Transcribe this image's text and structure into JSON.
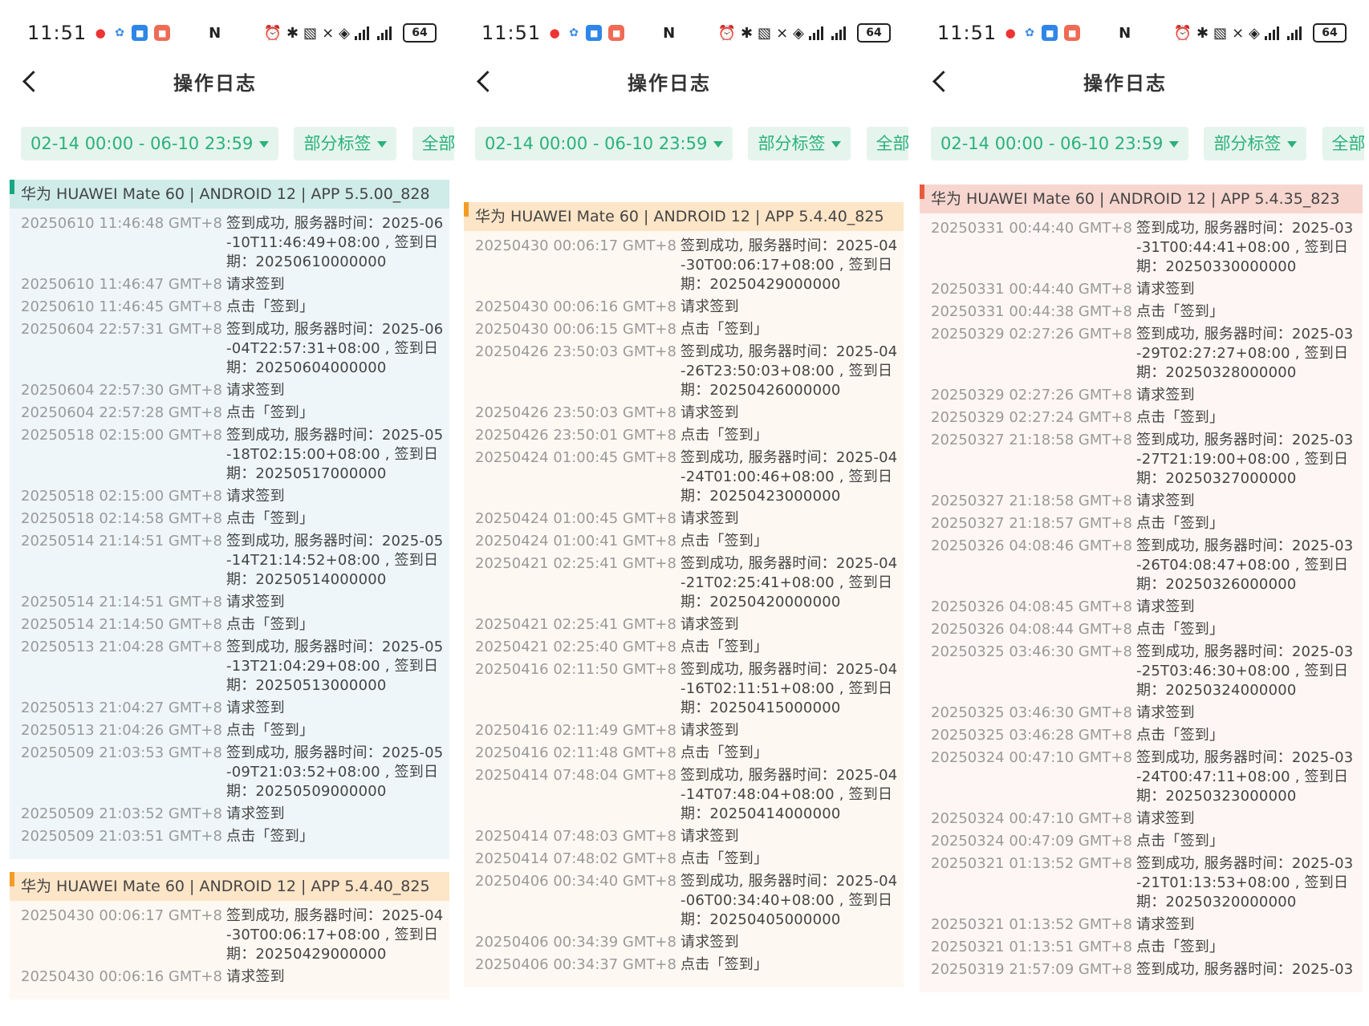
{
  "colors": {
    "accent": "#29b27a",
    "chip_bg": "#e6f4ee",
    "group_blue": "#cfece9",
    "group_orange": "#fde5c7",
    "group_red": "#f7d6cf"
  },
  "status_bar": {
    "time": "11:51",
    "battery": "64",
    "icons": [
      "qq-icon",
      "pinwheel-icon",
      "app-icon",
      "app-icon",
      "nfc-icon",
      "alarm-icon",
      "bluetooth-icon",
      "vibrate-icon",
      "mute-icon",
      "wifi-icon",
      "signal-icon",
      "signal-icon",
      "battery-icon"
    ]
  },
  "nav": {
    "title": "操作日志"
  },
  "filters": {
    "date_range": "02-14 00:00 - 06-10 23:59",
    "tags": "部分标签",
    "all": "全部"
  },
  "panels": [
    {
      "groups": [
        {
          "color": "blue",
          "header": "华为 HUAWEI Mate 60 | ANDROID 12 | APP 5.5.00_828",
          "entries": [
            {
              "ts": "20250610 11:46:48 GMT+8",
              "msg": [
                "签到成功, 服务器时间：2025-06",
                "-10T11:46:49+08:00 , 签到日",
                "期：20250610000000"
              ]
            },
            {
              "ts": "20250610 11:46:47 GMT+8",
              "msg": [
                "请求签到"
              ]
            },
            {
              "ts": "20250610 11:46:45 GMT+8",
              "msg": [
                "点击「签到」"
              ]
            },
            {
              "ts": "20250604 22:57:31 GMT+8",
              "msg": [
                "签到成功, 服务器时间：2025-06",
                "-04T22:57:31+08:00 , 签到日",
                "期：20250604000000"
              ]
            },
            {
              "ts": "20250604 22:57:30 GMT+8",
              "msg": [
                "请求签到"
              ]
            },
            {
              "ts": "20250604 22:57:28 GMT+8",
              "msg": [
                "点击「签到」"
              ]
            },
            {
              "ts": "20250518 02:15:00 GMT+8",
              "msg": [
                "签到成功, 服务器时间：2025-05",
                "-18T02:15:00+08:00 , 签到日",
                "期：20250517000000"
              ]
            },
            {
              "ts": "20250518 02:15:00 GMT+8",
              "msg": [
                "请求签到"
              ]
            },
            {
              "ts": "20250518 02:14:58 GMT+8",
              "msg": [
                "点击「签到」"
              ]
            },
            {
              "ts": "20250514 21:14:51 GMT+8",
              "msg": [
                "签到成功, 服务器时间：2025-05",
                "-14T21:14:52+08:00 , 签到日",
                "期：20250514000000"
              ]
            },
            {
              "ts": "20250514 21:14:51 GMT+8",
              "msg": [
                "请求签到"
              ]
            },
            {
              "ts": "20250514 21:14:50 GMT+8",
              "msg": [
                "点击「签到」"
              ]
            },
            {
              "ts": "20250513 21:04:28 GMT+8",
              "msg": [
                "签到成功, 服务器时间：2025-05",
                "-13T21:04:29+08:00 , 签到日",
                "期：20250513000000"
              ]
            },
            {
              "ts": "20250513 21:04:27 GMT+8",
              "msg": [
                "请求签到"
              ]
            },
            {
              "ts": "20250513 21:04:26 GMT+8",
              "msg": [
                "点击「签到」"
              ]
            },
            {
              "ts": "20250509 21:03:53 GMT+8",
              "msg": [
                "签到成功, 服务器时间：2025-05",
                "-09T21:03:52+08:00 , 签到日",
                "期：20250509000000"
              ]
            },
            {
              "ts": "20250509 21:03:52 GMT+8",
              "msg": [
                "请求签到"
              ]
            },
            {
              "ts": "20250509 21:03:51 GMT+8",
              "msg": [
                "点击「签到」"
              ]
            }
          ]
        },
        {
          "color": "orange",
          "header": "华为 HUAWEI Mate 60 | ANDROID 12 | APP 5.4.40_825",
          "entries": [
            {
              "ts": "20250430 00:06:17 GMT+8",
              "msg": [
                "签到成功, 服务器时间：2025-04",
                "-30T00:06:17+08:00 , 签到日",
                "期：20250429000000"
              ]
            },
            {
              "ts": "20250430 00:06:16 GMT+8",
              "msg": [
                "请求签到"
              ]
            }
          ]
        }
      ]
    },
    {
      "groups": [
        {
          "color": "orange",
          "header": "华为 HUAWEI Mate 60 | ANDROID 12 | APP 5.4.40_825",
          "entries": [
            {
              "ts": "20250430 00:06:17 GMT+8",
              "msg": [
                "签到成功, 服务器时间：2025-04",
                "-30T00:06:17+08:00 , 签到日",
                "期：20250429000000"
              ]
            },
            {
              "ts": "20250430 00:06:16 GMT+8",
              "msg": [
                "请求签到"
              ]
            },
            {
              "ts": "20250430 00:06:15 GMT+8",
              "msg": [
                "点击「签到」"
              ]
            },
            {
              "ts": "20250426 23:50:03 GMT+8",
              "msg": [
                "签到成功, 服务器时间：2025-04",
                "-26T23:50:03+08:00 , 签到日",
                "期：20250426000000"
              ]
            },
            {
              "ts": "20250426 23:50:03 GMT+8",
              "msg": [
                "请求签到"
              ]
            },
            {
              "ts": "20250426 23:50:01 GMT+8",
              "msg": [
                "点击「签到」"
              ]
            },
            {
              "ts": "20250424 01:00:45 GMT+8",
              "msg": [
                "签到成功, 服务器时间：2025-04",
                "-24T01:00:46+08:00 , 签到日",
                "期：20250423000000"
              ]
            },
            {
              "ts": "20250424 01:00:45 GMT+8",
              "msg": [
                "请求签到"
              ]
            },
            {
              "ts": "20250424 01:00:41 GMT+8",
              "msg": [
                "点击「签到」"
              ]
            },
            {
              "ts": "20250421 02:25:41 GMT+8",
              "msg": [
                "签到成功, 服务器时间：2025-04",
                "-21T02:25:41+08:00 , 签到日",
                "期：20250420000000"
              ]
            },
            {
              "ts": "20250421 02:25:41 GMT+8",
              "msg": [
                "请求签到"
              ]
            },
            {
              "ts": "20250421 02:25:40 GMT+8",
              "msg": [
                "点击「签到」"
              ]
            },
            {
              "ts": "20250416 02:11:50 GMT+8",
              "msg": [
                "签到成功, 服务器时间：2025-04",
                "-16T02:11:51+08:00 , 签到日",
                "期：20250415000000"
              ]
            },
            {
              "ts": "20250416 02:11:49 GMT+8",
              "msg": [
                "请求签到"
              ]
            },
            {
              "ts": "20250416 02:11:48 GMT+8",
              "msg": [
                "点击「签到」"
              ]
            },
            {
              "ts": "20250414 07:48:04 GMT+8",
              "msg": [
                "签到成功, 服务器时间：2025-04",
                "-14T07:48:04+08:00 , 签到日",
                "期：20250414000000"
              ]
            },
            {
              "ts": "20250414 07:48:03 GMT+8",
              "msg": [
                "请求签到"
              ]
            },
            {
              "ts": "20250414 07:48:02 GMT+8",
              "msg": [
                "点击「签到」"
              ]
            },
            {
              "ts": "20250406 00:34:40 GMT+8",
              "msg": [
                "签到成功, 服务器时间：2025-04",
                "-06T00:34:40+08:00 , 签到日",
                "期：20250405000000"
              ]
            },
            {
              "ts": "20250406 00:34:39 GMT+8",
              "msg": [
                "请求签到"
              ]
            },
            {
              "ts": "20250406 00:34:37 GMT+8",
              "msg": [
                "点击「签到」"
              ]
            }
          ]
        }
      ]
    },
    {
      "groups": [
        {
          "color": "red",
          "header": "华为 HUAWEI Mate 60 | ANDROID 12 | APP 5.4.35_823",
          "entries": [
            {
              "ts": "20250331 00:44:40 GMT+8",
              "msg": [
                "签到成功, 服务器时间：2025-03",
                "-31T00:44:41+08:00 , 签到日",
                "期：20250330000000"
              ]
            },
            {
              "ts": "20250331 00:44:40 GMT+8",
              "msg": [
                "请求签到"
              ]
            },
            {
              "ts": "20250331 00:44:38 GMT+8",
              "msg": [
                "点击「签到」"
              ]
            },
            {
              "ts": "20250329 02:27:26 GMT+8",
              "msg": [
                "签到成功, 服务器时间：2025-03",
                "-29T02:27:27+08:00 , 签到日",
                "期：20250328000000"
              ]
            },
            {
              "ts": "20250329 02:27:26 GMT+8",
              "msg": [
                "请求签到"
              ]
            },
            {
              "ts": "20250329 02:27:24 GMT+8",
              "msg": [
                "点击「签到」"
              ]
            },
            {
              "ts": "20250327 21:18:58 GMT+8",
              "msg": [
                "签到成功, 服务器时间：2025-03",
                "-27T21:19:00+08:00 , 签到日",
                "期：20250327000000"
              ]
            },
            {
              "ts": "20250327 21:18:58 GMT+8",
              "msg": [
                "请求签到"
              ]
            },
            {
              "ts": "20250327 21:18:57 GMT+8",
              "msg": [
                "点击「签到」"
              ]
            },
            {
              "ts": "20250326 04:08:46 GMT+8",
              "msg": [
                "签到成功, 服务器时间：2025-03",
                "-26T04:08:47+08:00 , 签到日",
                "期：20250326000000"
              ]
            },
            {
              "ts": "20250326 04:08:45 GMT+8",
              "msg": [
                "请求签到"
              ]
            },
            {
              "ts": "20250326 04:08:44 GMT+8",
              "msg": [
                "点击「签到」"
              ]
            },
            {
              "ts": "20250325 03:46:30 GMT+8",
              "msg": [
                "签到成功, 服务器时间：2025-03",
                "-25T03:46:30+08:00 , 签到日",
                "期：20250324000000"
              ]
            },
            {
              "ts": "20250325 03:46:30 GMT+8",
              "msg": [
                "请求签到"
              ]
            },
            {
              "ts": "20250325 03:46:28 GMT+8",
              "msg": [
                "点击「签到」"
              ]
            },
            {
              "ts": "20250324 00:47:10 GMT+8",
              "msg": [
                "签到成功, 服务器时间：2025-03",
                "-24T00:47:11+08:00 , 签到日",
                "期：20250323000000"
              ]
            },
            {
              "ts": "20250324 00:47:10 GMT+8",
              "msg": [
                "请求签到"
              ]
            },
            {
              "ts": "20250324 00:47:09 GMT+8",
              "msg": [
                "点击「签到」"
              ]
            },
            {
              "ts": "20250321 01:13:52 GMT+8",
              "msg": [
                "签到成功, 服务器时间：2025-03",
                "-21T01:13:53+08:00 , 签到日",
                "期：20250320000000"
              ]
            },
            {
              "ts": "20250321 01:13:52 GMT+8",
              "msg": [
                "请求签到"
              ]
            },
            {
              "ts": "20250321 01:13:51 GMT+8",
              "msg": [
                "点击「签到」"
              ]
            },
            {
              "ts": "20250319 21:57:09 GMT+8",
              "msg": [
                "签到成功, 服务器时间：2025-03"
              ]
            }
          ]
        }
      ]
    }
  ]
}
